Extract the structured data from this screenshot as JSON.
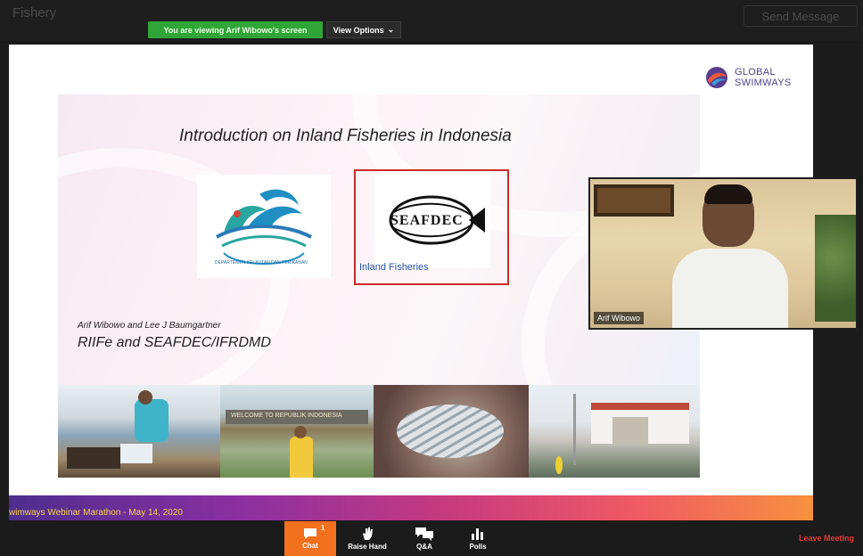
{
  "topbar": {
    "sharing_banner": "You are viewing Arif Wibowo's screen",
    "view_options": "View Options",
    "ghost_left": "Fishery",
    "ghost_right": "Send Message"
  },
  "slide": {
    "brand_logo": {
      "line1": "GLOBAL",
      "line2": "SWIMWAYS"
    },
    "title": "Introduction on Inland Fisheries in Indonesia",
    "logo1_caption": "DEPARTEMEN KELAUTAN DAN PERIKANAN",
    "logo2_text": "SEAFDEC",
    "logo2_caption": "Inland Fisheries",
    "authors": "Arif Wibowo  and Lee J Baumgartner",
    "organizations": "RIIFe and SEAFDEC/IFRDMD",
    "photo2_sign": "WELCOME TO REPUBLIK INDONESIA",
    "footer_banner": "wimways Webinar Marathon - May 14, 2020"
  },
  "video": {
    "participant_name": "Arif Wibowo"
  },
  "toolbar": {
    "chat_label": "Chat",
    "chat_badge": "1",
    "raise_hand_label": "Raise Hand",
    "qa_label": "Q&A",
    "polls_label": "Polls",
    "leave_label": "Leave Meeting"
  },
  "colors": {
    "share_banner": "#2fa537",
    "chat_active": "#f2701e",
    "leave": "#e23a37",
    "brand_purple": "#4d4388"
  }
}
